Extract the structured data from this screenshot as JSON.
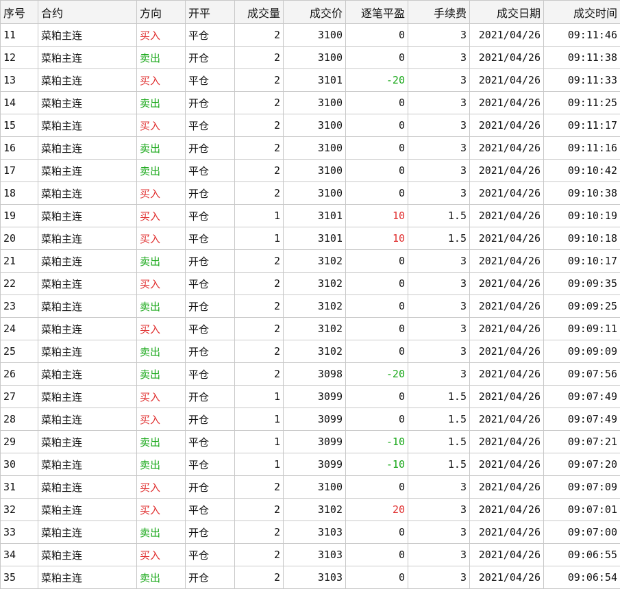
{
  "columns": [
    {
      "key": "id",
      "label": "序号",
      "align": "left"
    },
    {
      "key": "contract",
      "label": "合约",
      "align": "left"
    },
    {
      "key": "direction",
      "label": "方向",
      "align": "left"
    },
    {
      "key": "offset",
      "label": "开平",
      "align": "left"
    },
    {
      "key": "qty",
      "label": "成交量",
      "align": "right"
    },
    {
      "key": "price",
      "label": "成交价",
      "align": "right"
    },
    {
      "key": "pl",
      "label": "逐笔平盈",
      "align": "right"
    },
    {
      "key": "fee",
      "label": "手续费",
      "align": "right"
    },
    {
      "key": "date",
      "label": "成交日期",
      "align": "right"
    },
    {
      "key": "time",
      "label": "成交时间",
      "align": "right"
    }
  ],
  "colors": {
    "buy": "#e03030",
    "sell": "#1aa81a",
    "profit": "#e03030",
    "loss": "#1aa81a"
  },
  "rows": [
    {
      "id": "11",
      "contract": "菜粕主连",
      "direction": "买入",
      "offset": "平仓",
      "qty": "2",
      "price": "3100",
      "pl": "0",
      "fee": "3",
      "date": "2021/04/26",
      "time": "09:11:46"
    },
    {
      "id": "12",
      "contract": "菜粕主连",
      "direction": "卖出",
      "offset": "开仓",
      "qty": "2",
      "price": "3100",
      "pl": "0",
      "fee": "3",
      "date": "2021/04/26",
      "time": "09:11:38"
    },
    {
      "id": "13",
      "contract": "菜粕主连",
      "direction": "买入",
      "offset": "平仓",
      "qty": "2",
      "price": "3101",
      "pl": "-20",
      "fee": "3",
      "date": "2021/04/26",
      "time": "09:11:33"
    },
    {
      "id": "14",
      "contract": "菜粕主连",
      "direction": "卖出",
      "offset": "开仓",
      "qty": "2",
      "price": "3100",
      "pl": "0",
      "fee": "3",
      "date": "2021/04/26",
      "time": "09:11:25"
    },
    {
      "id": "15",
      "contract": "菜粕主连",
      "direction": "买入",
      "offset": "平仓",
      "qty": "2",
      "price": "3100",
      "pl": "0",
      "fee": "3",
      "date": "2021/04/26",
      "time": "09:11:17"
    },
    {
      "id": "16",
      "contract": "菜粕主连",
      "direction": "卖出",
      "offset": "开仓",
      "qty": "2",
      "price": "3100",
      "pl": "0",
      "fee": "3",
      "date": "2021/04/26",
      "time": "09:11:16"
    },
    {
      "id": "17",
      "contract": "菜粕主连",
      "direction": "卖出",
      "offset": "平仓",
      "qty": "2",
      "price": "3100",
      "pl": "0",
      "fee": "3",
      "date": "2021/04/26",
      "time": "09:10:42"
    },
    {
      "id": "18",
      "contract": "菜粕主连",
      "direction": "买入",
      "offset": "开仓",
      "qty": "2",
      "price": "3100",
      "pl": "0",
      "fee": "3",
      "date": "2021/04/26",
      "time": "09:10:38"
    },
    {
      "id": "19",
      "contract": "菜粕主连",
      "direction": "买入",
      "offset": "平仓",
      "qty": "1",
      "price": "3101",
      "pl": "10",
      "fee": "1.5",
      "date": "2021/04/26",
      "time": "09:10:19"
    },
    {
      "id": "20",
      "contract": "菜粕主连",
      "direction": "买入",
      "offset": "平仓",
      "qty": "1",
      "price": "3101",
      "pl": "10",
      "fee": "1.5",
      "date": "2021/04/26",
      "time": "09:10:18"
    },
    {
      "id": "21",
      "contract": "菜粕主连",
      "direction": "卖出",
      "offset": "开仓",
      "qty": "2",
      "price": "3102",
      "pl": "0",
      "fee": "3",
      "date": "2021/04/26",
      "time": "09:10:17"
    },
    {
      "id": "22",
      "contract": "菜粕主连",
      "direction": "买入",
      "offset": "平仓",
      "qty": "2",
      "price": "3102",
      "pl": "0",
      "fee": "3",
      "date": "2021/04/26",
      "time": "09:09:35"
    },
    {
      "id": "23",
      "contract": "菜粕主连",
      "direction": "卖出",
      "offset": "开仓",
      "qty": "2",
      "price": "3102",
      "pl": "0",
      "fee": "3",
      "date": "2021/04/26",
      "time": "09:09:25"
    },
    {
      "id": "24",
      "contract": "菜粕主连",
      "direction": "买入",
      "offset": "平仓",
      "qty": "2",
      "price": "3102",
      "pl": "0",
      "fee": "3",
      "date": "2021/04/26",
      "time": "09:09:11"
    },
    {
      "id": "25",
      "contract": "菜粕主连",
      "direction": "卖出",
      "offset": "开仓",
      "qty": "2",
      "price": "3102",
      "pl": "0",
      "fee": "3",
      "date": "2021/04/26",
      "time": "09:09:09"
    },
    {
      "id": "26",
      "contract": "菜粕主连",
      "direction": "卖出",
      "offset": "平仓",
      "qty": "2",
      "price": "3098",
      "pl": "-20",
      "fee": "3",
      "date": "2021/04/26",
      "time": "09:07:56"
    },
    {
      "id": "27",
      "contract": "菜粕主连",
      "direction": "买入",
      "offset": "开仓",
      "qty": "1",
      "price": "3099",
      "pl": "0",
      "fee": "1.5",
      "date": "2021/04/26",
      "time": "09:07:49"
    },
    {
      "id": "28",
      "contract": "菜粕主连",
      "direction": "买入",
      "offset": "开仓",
      "qty": "1",
      "price": "3099",
      "pl": "0",
      "fee": "1.5",
      "date": "2021/04/26",
      "time": "09:07:49"
    },
    {
      "id": "29",
      "contract": "菜粕主连",
      "direction": "卖出",
      "offset": "平仓",
      "qty": "1",
      "price": "3099",
      "pl": "-10",
      "fee": "1.5",
      "date": "2021/04/26",
      "time": "09:07:21"
    },
    {
      "id": "30",
      "contract": "菜粕主连",
      "direction": "卖出",
      "offset": "平仓",
      "qty": "1",
      "price": "3099",
      "pl": "-10",
      "fee": "1.5",
      "date": "2021/04/26",
      "time": "09:07:20"
    },
    {
      "id": "31",
      "contract": "菜粕主连",
      "direction": "买入",
      "offset": "开仓",
      "qty": "2",
      "price": "3100",
      "pl": "0",
      "fee": "3",
      "date": "2021/04/26",
      "time": "09:07:09"
    },
    {
      "id": "32",
      "contract": "菜粕主连",
      "direction": "买入",
      "offset": "平仓",
      "qty": "2",
      "price": "3102",
      "pl": "20",
      "fee": "3",
      "date": "2021/04/26",
      "time": "09:07:01"
    },
    {
      "id": "33",
      "contract": "菜粕主连",
      "direction": "卖出",
      "offset": "开仓",
      "qty": "2",
      "price": "3103",
      "pl": "0",
      "fee": "3",
      "date": "2021/04/26",
      "time": "09:07:00"
    },
    {
      "id": "34",
      "contract": "菜粕主连",
      "direction": "买入",
      "offset": "平仓",
      "qty": "2",
      "price": "3103",
      "pl": "0",
      "fee": "3",
      "date": "2021/04/26",
      "time": "09:06:55"
    },
    {
      "id": "35",
      "contract": "菜粕主连",
      "direction": "卖出",
      "offset": "开仓",
      "qty": "2",
      "price": "3103",
      "pl": "0",
      "fee": "3",
      "date": "2021/04/26",
      "time": "09:06:54"
    }
  ]
}
